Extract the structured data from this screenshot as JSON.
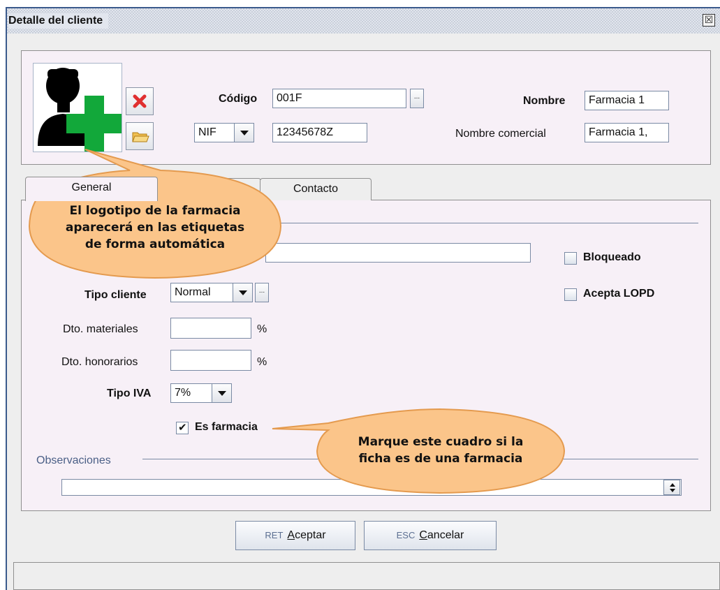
{
  "window": {
    "title": "Detalle del cliente",
    "close_glyph": "☒"
  },
  "header": {
    "codigo_label": "Código",
    "codigo_value": "001F",
    "codigo_lookup_label": "...",
    "doc_type_value": "NIF",
    "doc_number_value": "12345678Z",
    "nombre_label": "Nombre",
    "nombre_value": "Farmacia 1",
    "nombre_comercial_label": "Nombre comercial",
    "nombre_comercial_value": "Farmacia 1,"
  },
  "tabs": [
    {
      "label": "General"
    },
    {
      "label": ""
    },
    {
      "label": "Contacto"
    }
  ],
  "general": {
    "bloqueado_label": "Bloqueado",
    "acepta_lopd_label": "Acepta LOPD",
    "tipo_cliente_label": "Tipo cliente",
    "tipo_cliente_value": "Normal",
    "tipo_cliente_lookup_label": "...",
    "dto_materiales_label": "Dto. materiales",
    "dto_materiales_value": "",
    "percent_sign": "%",
    "dto_honorarios_label": "Dto. honorarios",
    "dto_honorarios_value": "",
    "tipo_iva_label": "Tipo IVA",
    "tipo_iva_value": "7%",
    "es_farmacia_label": "Es farmacia",
    "observaciones_label": "Observaciones",
    "observaciones_value": ""
  },
  "buttons": {
    "accept_key": "RET",
    "accept_mnemonic": "A",
    "accept_rest": "ceptar",
    "cancel_key": "ESC",
    "cancel_mnemonic": "C",
    "cancel_rest": "ancelar"
  },
  "callouts": {
    "logo": [
      "El logotipo de la farmacia",
      "aparecerá en las etiquetas",
      "de forma automática"
    ],
    "farmacia": [
      "Marque este cuadro si la",
      "ficha es de una farmacia"
    ]
  },
  "colors": {
    "callout_fill": "#fbc58a",
    "callout_stroke": "#e49a4e",
    "panel_bg": "#f7f0f7",
    "delete_icon": "#e03030",
    "folder_icon": "#f0c050",
    "cross_green": "#12a83a"
  },
  "icons": {
    "logo": "user-add-icon",
    "delete": "delete-x-icon",
    "open": "folder-icon"
  }
}
